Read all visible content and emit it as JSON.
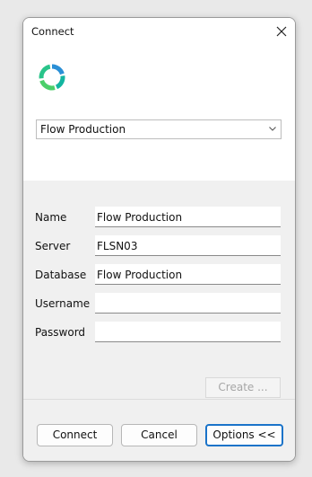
{
  "window": {
    "title": "Connect"
  },
  "connection": {
    "selected": "Flow Production"
  },
  "fields": {
    "name_label": "Name",
    "name_value": "Flow Production",
    "server_label": "Server",
    "server_value": "FLSN03",
    "database_label": "Database",
    "database_value": "Flow Production",
    "username_label": "Username",
    "username_value": "",
    "password_label": "Password",
    "password_value": ""
  },
  "buttons": {
    "create": "Create ...",
    "connect": "Connect",
    "cancel": "Cancel",
    "options": "Options <<"
  },
  "icons": {
    "close": "close-icon",
    "logo": "ring-logo-icon",
    "dropdown": "chevron-down-icon"
  },
  "colors": {
    "accent": "#1a73c9",
    "logo_teal": "#13b5a0",
    "logo_blue": "#2a8fd6",
    "logo_green": "#4ccf6a"
  }
}
